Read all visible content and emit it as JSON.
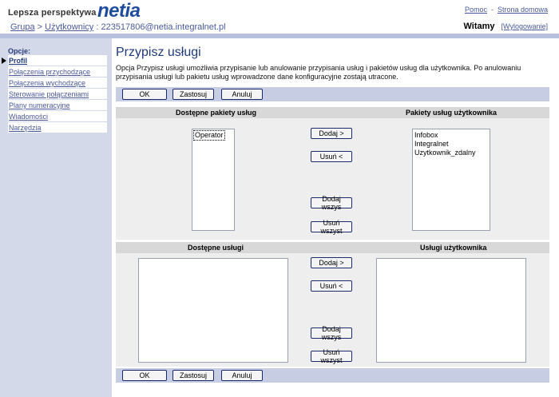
{
  "header": {
    "tagline": "Lepsza perspektywa",
    "logo": "netia",
    "links": [
      "Pomoc",
      "Strona domowa"
    ],
    "link_separator": "-",
    "breadcrumb": {
      "group": "Grupa",
      "sep1": ">",
      "users": "Użytkownicy",
      "sep2": ":",
      "account": "223517806@netia.integralnet.pl"
    },
    "welcome": "Witamy",
    "logout": "[Wylogowanie]"
  },
  "sidebar": {
    "heading": "Opcje:",
    "items": [
      {
        "label": "Profil",
        "active": true
      },
      {
        "label": "Połączenia przychodzące",
        "active": false
      },
      {
        "label": "Połączenia wychodzące",
        "active": false
      },
      {
        "label": "Sterowanie połączeniami",
        "active": false
      },
      {
        "label": "Plany numeracyjne",
        "active": false
      },
      {
        "label": "Wiadomości",
        "active": false
      },
      {
        "label": "Narzędzia",
        "active": false
      }
    ]
  },
  "main": {
    "title": "Przypisz usługi",
    "description": "Opcja Przypisz usługi umożliwia przypisanie lub anulowanie przypisania usług i pakietów usług dla użytkownika. Po anulowaniu przypisania usługi lub pakietu usług wprowadzone dane konfiguracyjne zostają utracone.",
    "buttons": {
      "ok": "OK",
      "apply": "Zastosuj",
      "cancel": "Anuluj"
    },
    "packages": {
      "available_header": "Dostępne pakiety usług",
      "user_header": "Pakiety usług użytkownika",
      "available": [
        "Operator"
      ],
      "user": [
        "Infobox",
        "Integralnet",
        "Uzytkownik_zdalny"
      ],
      "add": "Dodaj >",
      "remove": "Usuń <",
      "add_all": "Dodaj wszys",
      "remove_all": "Usuń wszyst"
    },
    "services": {
      "available_header": "Dostępne usługi",
      "user_header": "Usługi użytkownika",
      "available": [],
      "user": [],
      "add": "Dodaj >",
      "remove": "Usuń <",
      "add_all": "Dodaj wszys",
      "remove_all": "Usuń wszyst"
    }
  },
  "colors": {
    "logo": "#1f4b9e",
    "title": "#1f3a7a",
    "sidebar": "#d4d9ea",
    "bar": "#c7cde3"
  }
}
